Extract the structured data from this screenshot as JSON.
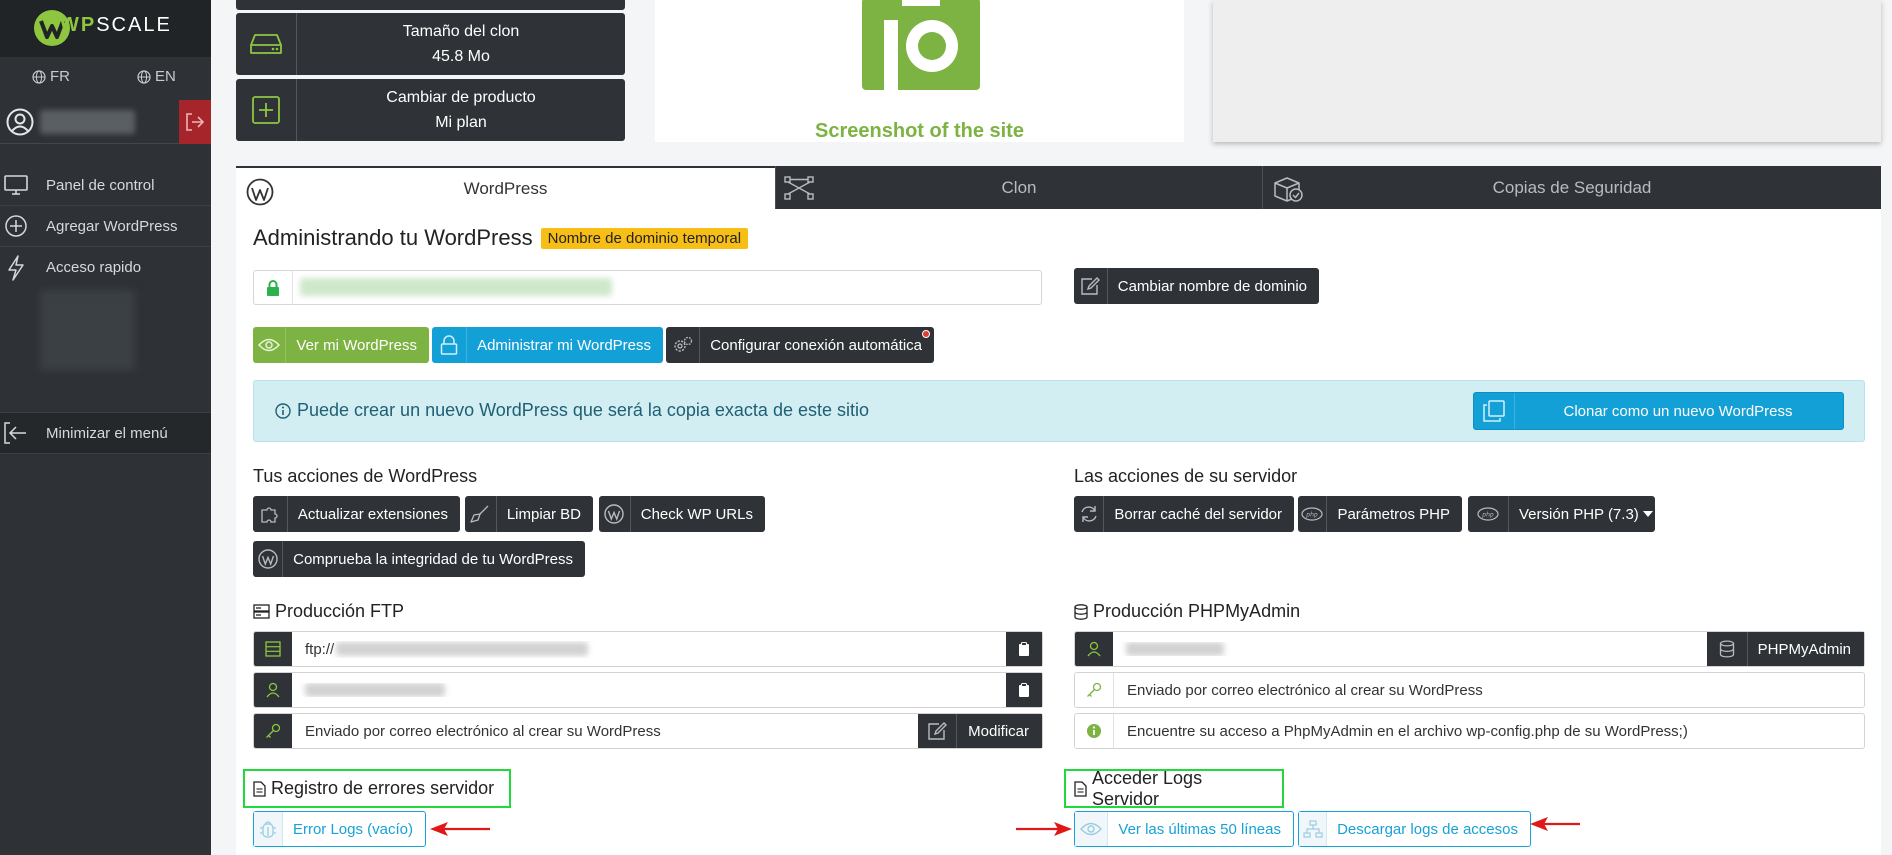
{
  "brand": {
    "name_prefix": "WP",
    "name_suffix": "SCALE"
  },
  "sidebar": {
    "lang_fr": "FR",
    "lang_en": "EN",
    "items": [
      {
        "label": "Panel de control",
        "icon": "monitor-icon"
      },
      {
        "label": "Agregar WordPress",
        "icon": "plus-circle-icon"
      },
      {
        "label": "Acceso rapido",
        "icon": "bolt-icon"
      }
    ],
    "minimize_label": "Minimizar el menú"
  },
  "cards": {
    "clone_size": {
      "title": "Tamaño del clon",
      "value": "45.8 Mo"
    },
    "change_product": {
      "title": "Cambiar de producto",
      "value": "Mi plan"
    }
  },
  "screenshot_caption": "Screenshot of the site",
  "tabs": [
    {
      "label": "WordPress",
      "icon": "wordpress-icon",
      "active": true
    },
    {
      "label": "Clon",
      "icon": "network-icon",
      "active": false
    },
    {
      "label": "Copias de Seguridad",
      "icon": "backup-box-icon",
      "active": false
    }
  ],
  "main": {
    "title": "Administrando tu WordPress",
    "badge": "Nombre de dominio temporal",
    "change_domain_button": "Cambiar nombre de dominio",
    "buttons": {
      "view": "Ver mi WordPress",
      "admin": "Administrar mi WordPress",
      "autologin": "Configurar conexión automática"
    },
    "info_text": "Puede crear un nuevo WordPress que será la copia exacta de este sitio",
    "clone_button": "Clonar como un nuevo WordPress",
    "wp_actions_title": "Tus acciones de WordPress",
    "wp_actions": {
      "update": "Actualizar extensiones",
      "clean_db": "Limpiar BD",
      "check_urls": "Check WP URLs",
      "integrity": "Comprueba la integridad de tu WordPress"
    },
    "server_actions_title": "Las acciones de su servidor",
    "server_actions": {
      "clear_cache": "Borrar caché del servidor",
      "php_params": "Parámetros PHP",
      "php_version": "Versión PHP (7.3)"
    },
    "ftp": {
      "title": "Producción FTP",
      "host_prefix": "ftp://",
      "password_text": "Enviado por correo electrónico al crear su WordPress",
      "modify_button": "Modificar"
    },
    "phpmyadmin": {
      "title": "Producción PHPMyAdmin",
      "button": "PHPMyAdmin",
      "password_text": "Enviado por correo electrónico al crear su WordPress",
      "info_text": "Encuentre su acceso a PhpMyAdmin en el archivo wp-config.php de su WordPress;)"
    },
    "error_logs": {
      "title": "Registro de errores servidor",
      "button": "Error Logs (vacío)"
    },
    "access_logs": {
      "title": "Acceder Logs Servidor",
      "view_button": "Ver las últimas 50 líneas",
      "download_button": "Descargar logs de accesos"
    }
  },
  "colors": {
    "accent_green": "#7cb342",
    "accent_blue": "#13a0d6",
    "dark": "#2f3337",
    "highlight": "#23d83a",
    "arrow": "#e01818"
  }
}
